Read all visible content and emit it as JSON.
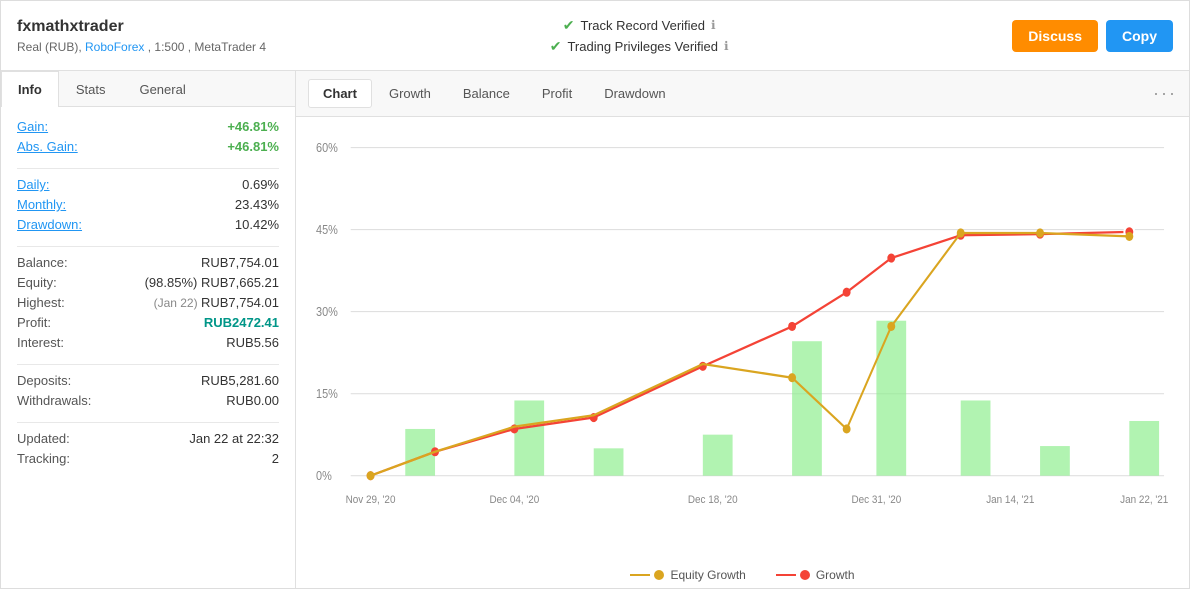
{
  "header": {
    "trader_name": "fxmathxtrader",
    "trader_details": "Real (RUB), RoboForex , 1:500 , MetaTrader 4",
    "verified1": "Track Record Verified",
    "verified2": "Trading Privileges Verified",
    "btn_discuss": "Discuss",
    "btn_copy": "Copy"
  },
  "left_panel": {
    "tabs": [
      "Info",
      "Stats",
      "General"
    ],
    "active_tab": "Info",
    "stats": {
      "gain_label": "Gain:",
      "gain_value": "+46.81%",
      "abs_gain_label": "Abs. Gain:",
      "abs_gain_value": "+46.81%",
      "daily_label": "Daily:",
      "daily_value": "0.69%",
      "monthly_label": "Monthly:",
      "monthly_value": "23.43%",
      "drawdown_label": "Drawdown:",
      "drawdown_value": "10.42%",
      "balance_label": "Balance:",
      "balance_value": "RUB7,754.01",
      "equity_label": "Equity:",
      "equity_value": "(98.85%) RUB7,665.21",
      "highest_label": "Highest:",
      "highest_value": "(Jan 22) RUB7,754.01",
      "profit_label": "Profit:",
      "profit_value": "RUB2472.41",
      "interest_label": "Interest:",
      "interest_value": "RUB5.56",
      "deposits_label": "Deposits:",
      "deposits_value": "RUB5,281.60",
      "withdrawals_label": "Withdrawals:",
      "withdrawals_value": "RUB0.00",
      "updated_label": "Updated:",
      "updated_value": "Jan 22 at 22:32",
      "tracking_label": "Tracking:",
      "tracking_value": "2"
    }
  },
  "chart_panel": {
    "tabs": [
      "Chart",
      "Growth",
      "Balance",
      "Profit",
      "Drawdown"
    ],
    "active_tab": "Chart",
    "more_icon": "···",
    "y_labels": [
      "60%",
      "45%",
      "30%",
      "15%",
      "0%"
    ],
    "x_labels": [
      "Nov 29, '20",
      "Dec 04, '20",
      "Dec 18, '20",
      "Dec 31, '20",
      "Jan 14, '21",
      "Jan 22, '21"
    ],
    "legend": {
      "equity_growth": "Equity Growth",
      "growth": "Growth"
    }
  }
}
